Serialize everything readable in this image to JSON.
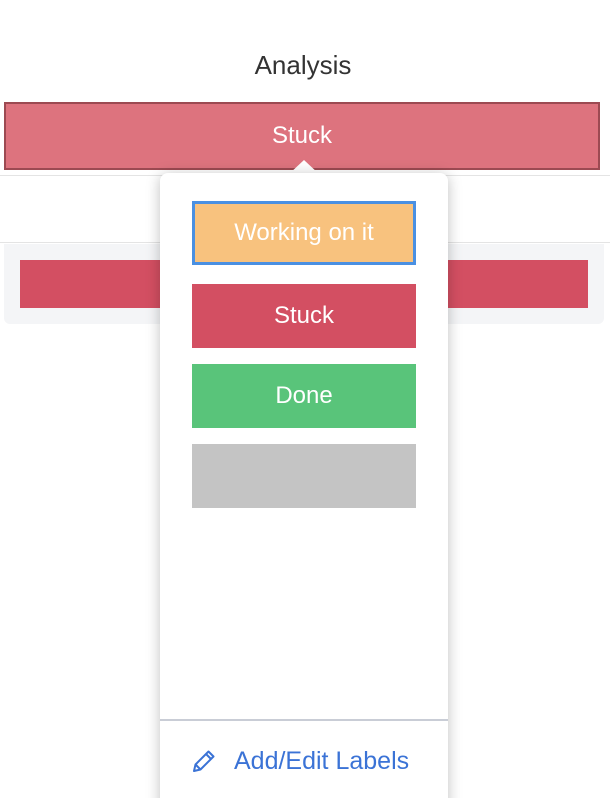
{
  "column": {
    "title": "Analysis"
  },
  "status_cell": {
    "label": "Stuck",
    "color": "#dd737e"
  },
  "group_row": {
    "status_color": "#d34f62"
  },
  "label_picker": {
    "options": [
      {
        "label": "Working on it",
        "color": "#f8c27e",
        "selected": true
      },
      {
        "label": "Stuck",
        "color": "#d34f62",
        "selected": false
      },
      {
        "label": "Done",
        "color": "#59c47a",
        "selected": false
      },
      {
        "label": "",
        "color": "#c4c4c4",
        "selected": false
      }
    ],
    "edit_link": {
      "label": "Add/Edit Labels",
      "icon": "pencil-icon",
      "color": "#3b73d6"
    }
  }
}
